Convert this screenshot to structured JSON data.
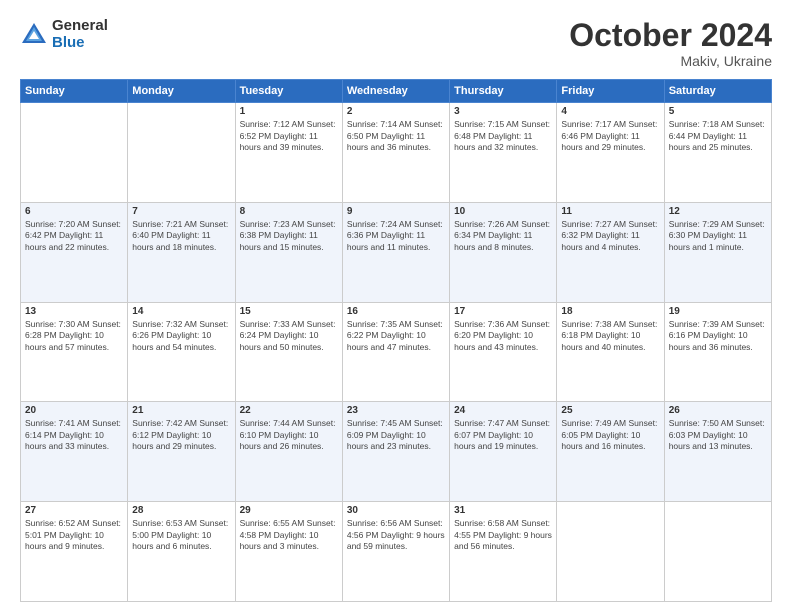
{
  "header": {
    "logo_general": "General",
    "logo_blue": "Blue",
    "month_title": "October 2024",
    "subtitle": "Makiv, Ukraine"
  },
  "weekdays": [
    "Sunday",
    "Monday",
    "Tuesday",
    "Wednesday",
    "Thursday",
    "Friday",
    "Saturday"
  ],
  "weeks": [
    [
      {
        "day": "",
        "info": ""
      },
      {
        "day": "",
        "info": ""
      },
      {
        "day": "1",
        "info": "Sunrise: 7:12 AM\nSunset: 6:52 PM\nDaylight: 11 hours and 39 minutes."
      },
      {
        "day": "2",
        "info": "Sunrise: 7:14 AM\nSunset: 6:50 PM\nDaylight: 11 hours and 36 minutes."
      },
      {
        "day": "3",
        "info": "Sunrise: 7:15 AM\nSunset: 6:48 PM\nDaylight: 11 hours and 32 minutes."
      },
      {
        "day": "4",
        "info": "Sunrise: 7:17 AM\nSunset: 6:46 PM\nDaylight: 11 hours and 29 minutes."
      },
      {
        "day": "5",
        "info": "Sunrise: 7:18 AM\nSunset: 6:44 PM\nDaylight: 11 hours and 25 minutes."
      }
    ],
    [
      {
        "day": "6",
        "info": "Sunrise: 7:20 AM\nSunset: 6:42 PM\nDaylight: 11 hours and 22 minutes."
      },
      {
        "day": "7",
        "info": "Sunrise: 7:21 AM\nSunset: 6:40 PM\nDaylight: 11 hours and 18 minutes."
      },
      {
        "day": "8",
        "info": "Sunrise: 7:23 AM\nSunset: 6:38 PM\nDaylight: 11 hours and 15 minutes."
      },
      {
        "day": "9",
        "info": "Sunrise: 7:24 AM\nSunset: 6:36 PM\nDaylight: 11 hours and 11 minutes."
      },
      {
        "day": "10",
        "info": "Sunrise: 7:26 AM\nSunset: 6:34 PM\nDaylight: 11 hours and 8 minutes."
      },
      {
        "day": "11",
        "info": "Sunrise: 7:27 AM\nSunset: 6:32 PM\nDaylight: 11 hours and 4 minutes."
      },
      {
        "day": "12",
        "info": "Sunrise: 7:29 AM\nSunset: 6:30 PM\nDaylight: 11 hours and 1 minute."
      }
    ],
    [
      {
        "day": "13",
        "info": "Sunrise: 7:30 AM\nSunset: 6:28 PM\nDaylight: 10 hours and 57 minutes."
      },
      {
        "day": "14",
        "info": "Sunrise: 7:32 AM\nSunset: 6:26 PM\nDaylight: 10 hours and 54 minutes."
      },
      {
        "day": "15",
        "info": "Sunrise: 7:33 AM\nSunset: 6:24 PM\nDaylight: 10 hours and 50 minutes."
      },
      {
        "day": "16",
        "info": "Sunrise: 7:35 AM\nSunset: 6:22 PM\nDaylight: 10 hours and 47 minutes."
      },
      {
        "day": "17",
        "info": "Sunrise: 7:36 AM\nSunset: 6:20 PM\nDaylight: 10 hours and 43 minutes."
      },
      {
        "day": "18",
        "info": "Sunrise: 7:38 AM\nSunset: 6:18 PM\nDaylight: 10 hours and 40 minutes."
      },
      {
        "day": "19",
        "info": "Sunrise: 7:39 AM\nSunset: 6:16 PM\nDaylight: 10 hours and 36 minutes."
      }
    ],
    [
      {
        "day": "20",
        "info": "Sunrise: 7:41 AM\nSunset: 6:14 PM\nDaylight: 10 hours and 33 minutes."
      },
      {
        "day": "21",
        "info": "Sunrise: 7:42 AM\nSunset: 6:12 PM\nDaylight: 10 hours and 29 minutes."
      },
      {
        "day": "22",
        "info": "Sunrise: 7:44 AM\nSunset: 6:10 PM\nDaylight: 10 hours and 26 minutes."
      },
      {
        "day": "23",
        "info": "Sunrise: 7:45 AM\nSunset: 6:09 PM\nDaylight: 10 hours and 23 minutes."
      },
      {
        "day": "24",
        "info": "Sunrise: 7:47 AM\nSunset: 6:07 PM\nDaylight: 10 hours and 19 minutes."
      },
      {
        "day": "25",
        "info": "Sunrise: 7:49 AM\nSunset: 6:05 PM\nDaylight: 10 hours and 16 minutes."
      },
      {
        "day": "26",
        "info": "Sunrise: 7:50 AM\nSunset: 6:03 PM\nDaylight: 10 hours and 13 minutes."
      }
    ],
    [
      {
        "day": "27",
        "info": "Sunrise: 6:52 AM\nSunset: 5:01 PM\nDaylight: 10 hours and 9 minutes."
      },
      {
        "day": "28",
        "info": "Sunrise: 6:53 AM\nSunset: 5:00 PM\nDaylight: 10 hours and 6 minutes."
      },
      {
        "day": "29",
        "info": "Sunrise: 6:55 AM\nSunset: 4:58 PM\nDaylight: 10 hours and 3 minutes."
      },
      {
        "day": "30",
        "info": "Sunrise: 6:56 AM\nSunset: 4:56 PM\nDaylight: 9 hours and 59 minutes."
      },
      {
        "day": "31",
        "info": "Sunrise: 6:58 AM\nSunset: 4:55 PM\nDaylight: 9 hours and 56 minutes."
      },
      {
        "day": "",
        "info": ""
      },
      {
        "day": "",
        "info": ""
      }
    ]
  ]
}
